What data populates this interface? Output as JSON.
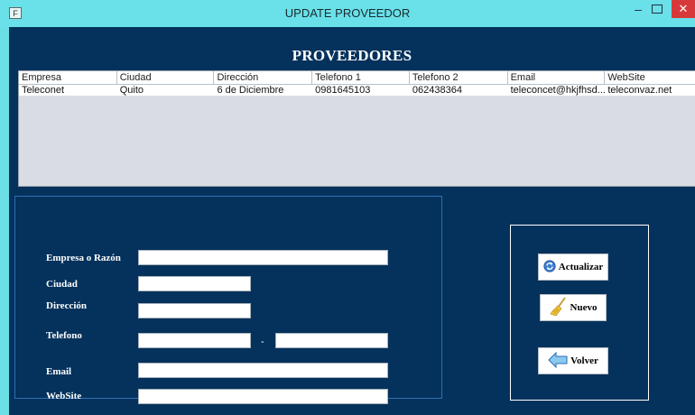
{
  "window": {
    "title": "UPDATE PROVEEDOR",
    "icon_glyph": "F",
    "minimize_glyph": "–",
    "close_glyph": "✕"
  },
  "heading": "PROVEEDORES",
  "table": {
    "columns": [
      "Empresa",
      "Ciudad",
      "Dirección",
      "Telefono 1",
      "Telefono 2",
      "Email",
      "WebSite"
    ],
    "rows": [
      [
        "Teleconet",
        "Quito",
        "6 de Diciembre",
        "0981645103",
        "062438364",
        "teleconcet@hkjfhsd...",
        "teleconvaz.net"
      ]
    ]
  },
  "form": {
    "labels": {
      "empresa": "Empresa o Razón",
      "ciudad": "Ciudad",
      "direccion": "Dirección",
      "telefono": "Telefono",
      "email": "Email",
      "website": "WebSite"
    },
    "values": {
      "empresa": "",
      "ciudad": "",
      "direccion": "",
      "telefono1": "",
      "telefono2": "",
      "email": "",
      "website": ""
    },
    "phone_separator": "-"
  },
  "actions": {
    "actualizar": "Actualizar",
    "nuevo": "Nuevo",
    "volver": "Volver",
    "icons": [
      "refresh-icon",
      "broom-icon",
      "back-arrow-icon"
    ]
  },
  "colors": {
    "titlebar": "#6ae0e8",
    "background": "#04325c",
    "close": "#d7393b"
  }
}
